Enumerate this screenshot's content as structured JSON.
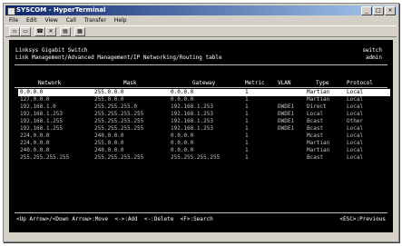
{
  "window": {
    "title": "SYSCOM - HyperTerminal"
  },
  "menu": [
    "File",
    "Edit",
    "View",
    "Call",
    "Transfer",
    "Help"
  ],
  "toolbar": [
    "new-icon",
    "open-icon",
    "call-icon",
    "disconnect-icon",
    "send-icon",
    "properties-icon"
  ],
  "terminal": {
    "header_left_1": "Linksys Gigabit Switch",
    "header_left_2": "Link Management/Advanced Management/IP Networking/Routing table",
    "header_right_1": "switch",
    "header_right_2": "admin",
    "columns": {
      "network": "Network",
      "mask": "Mask",
      "gateway": "Gateway",
      "metric": "Metric",
      "vlan": "VLAN",
      "type": "Type",
      "protocol": "Protocol"
    },
    "rows": [
      {
        "network": "0.0.0.0",
        "mask": "255.0.0.0",
        "gateway": "0.0.0.0",
        "metric": "1",
        "vlan": "",
        "type": "Martian",
        "protocol": "Local"
      },
      {
        "network": "127.0.0.0",
        "mask": "255.0.0.0",
        "gateway": "0.0.0.0",
        "metric": "1",
        "vlan": "",
        "type": "Martian",
        "protocol": "Local"
      },
      {
        "network": "192.168.1.0",
        "mask": "255.255.255.0",
        "gateway": "192.168.1.253",
        "metric": "1",
        "vlan": "DWDE1",
        "type": "Direct",
        "protocol": "Local"
      },
      {
        "network": "192.168.1.253",
        "mask": "255.255.255.255",
        "gateway": "192.168.1.253",
        "metric": "1",
        "vlan": "DWDE1",
        "type": "Local",
        "protocol": "Local"
      },
      {
        "network": "192.168.1.255",
        "mask": "255.255.255.255",
        "gateway": "192.168.1.253",
        "metric": "1",
        "vlan": "DWDE1",
        "type": "Bcast",
        "protocol": "Other"
      },
      {
        "network": "192.168.1.255",
        "mask": "255.255.255.255",
        "gateway": "192.168.1.253",
        "metric": "1",
        "vlan": "DWDE1",
        "type": "Bcast",
        "protocol": "Local"
      },
      {
        "network": "224.0.0.0",
        "mask": "240.0.0.0",
        "gateway": "0.0.0.0",
        "metric": "1",
        "vlan": "",
        "type": "Mcast",
        "protocol": "Local"
      },
      {
        "network": "224.0.0.0",
        "mask": "255.0.0.0",
        "gateway": "0.0.0.0",
        "metric": "1",
        "vlan": "",
        "type": "Martian",
        "protocol": "Local"
      },
      {
        "network": "240.0.0.0",
        "mask": "240.0.0.0",
        "gateway": "0.0.0.0",
        "metric": "1",
        "vlan": "",
        "type": "Martian",
        "protocol": "Local"
      },
      {
        "network": "255.255.255.255",
        "mask": "255.255.255.255",
        "gateway": "255.255.255.255",
        "metric": "1",
        "vlan": "",
        "type": "Bcast",
        "protocol": "Local"
      }
    ],
    "footer_left": "<Up Arrow>/<Down Arrow>:Move  <->:Add  <-:Delete  <F>:Search",
    "footer_right": "<ESC>:Previous"
  }
}
